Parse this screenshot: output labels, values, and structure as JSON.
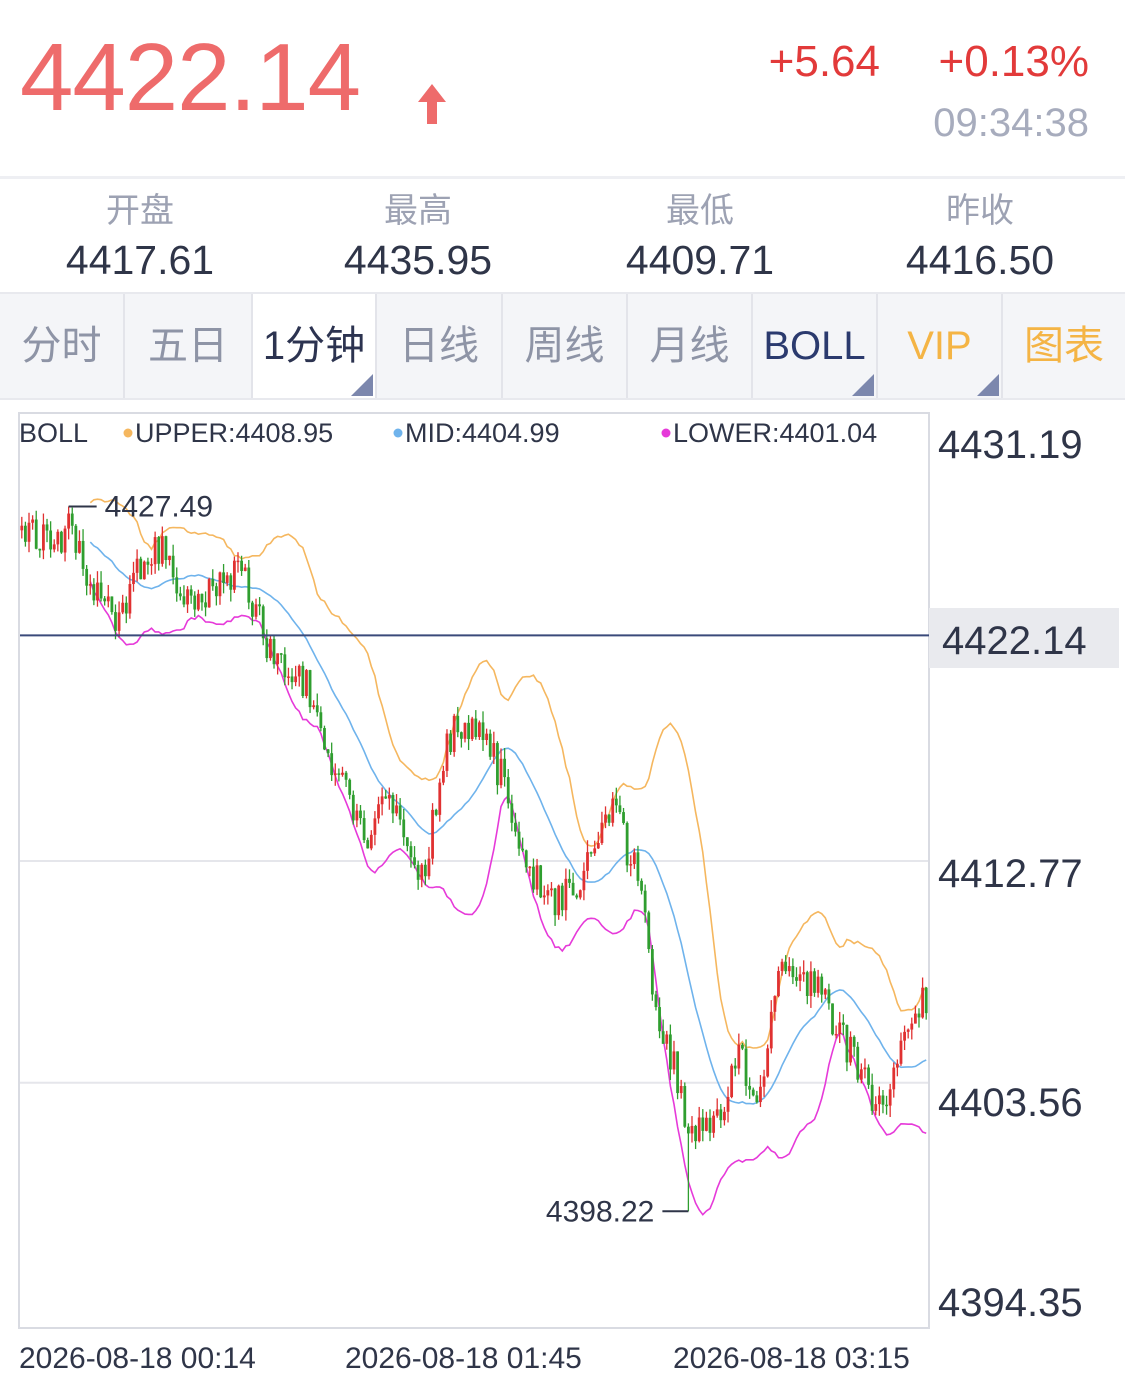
{
  "quote": {
    "price": "4422.14",
    "change": "+5.64",
    "change_pct": "+0.13%",
    "time": "09:34:38"
  },
  "stats": [
    {
      "label": "开盘",
      "value": "4417.61"
    },
    {
      "label": "最高",
      "value": "4435.95"
    },
    {
      "label": "最低",
      "value": "4409.71"
    },
    {
      "label": "昨收",
      "value": "4416.50"
    }
  ],
  "tabs": [
    {
      "label": "分时"
    },
    {
      "label": "五日"
    },
    {
      "label": "1分钟"
    },
    {
      "label": "日线"
    },
    {
      "label": "周线"
    },
    {
      "label": "月线"
    },
    {
      "label": "BOLL"
    },
    {
      "label": "VIP"
    },
    {
      "label": "图表"
    }
  ],
  "active_tab": "1分钟",
  "colors": {
    "price": "#ee6b6b",
    "up": "#e03131",
    "down": "#2f9e2f",
    "upper": "#f5b75f",
    "mid": "#6fb3ec",
    "lower": "#e63ad9",
    "current_line": "#3a4a7a",
    "muted": "#a7acbd"
  },
  "chart_data": {
    "type": "candlestick",
    "indicator": {
      "name": "BOLL",
      "upper_label": "UPPER:4408.95",
      "mid_label": "MID:4404.99",
      "lower_label": "LOWER:4401.04"
    },
    "y_ticks": [
      "4431.19",
      "4412.77",
      "4403.56",
      "4394.35"
    ],
    "ylim": [
      4394.35,
      4431.19
    ],
    "current_price": "4422.14",
    "annotations": {
      "high": {
        "text": "4427.49",
        "x_index": 13,
        "value": 4427.49
      },
      "low": {
        "text": "4398.22",
        "x_index": 185,
        "value": 4398.22
      }
    },
    "x_labels": [
      "2026-08-18 00:14",
      "2026-08-18 01:45",
      "2026-08-18 03:15"
    ],
    "grid": true,
    "anchors": [
      [
        0,
        4426.5
      ],
      [
        10,
        4425.9
      ],
      [
        15,
        4426.8
      ],
      [
        20,
        4424.2
      ],
      [
        28,
        4422.8
      ],
      [
        35,
        4425.3
      ],
      [
        40,
        4425.9
      ],
      [
        48,
        4423.0
      ],
      [
        55,
        4424.3
      ],
      [
        62,
        4425.0
      ],
      [
        70,
        4421.5
      ],
      [
        80,
        4420.0
      ],
      [
        88,
        4416.5
      ],
      [
        96,
        4413.5
      ],
      [
        104,
        4415.5
      ],
      [
        112,
        4412.2
      ],
      [
        120,
        4418.0
      ],
      [
        128,
        4418.5
      ],
      [
        135,
        4416.0
      ],
      [
        143,
        4412.0
      ],
      [
        150,
        4411.0
      ],
      [
        158,
        4412.5
      ],
      [
        165,
        4415.0
      ],
      [
        172,
        4412.0
      ],
      [
        178,
        4406.0
      ],
      [
        182,
        4404.5
      ],
      [
        186,
        4401.5
      ],
      [
        192,
        4401.5
      ],
      [
        200,
        4404.5
      ],
      [
        205,
        4403.0
      ],
      [
        212,
        4408.5
      ],
      [
        222,
        4407.5
      ],
      [
        228,
        4405.5
      ],
      [
        234,
        4404.0
      ],
      [
        240,
        4402.0
      ],
      [
        246,
        4405.5
      ],
      [
        251,
        4407.0
      ]
    ],
    "candle_count": 252
  }
}
